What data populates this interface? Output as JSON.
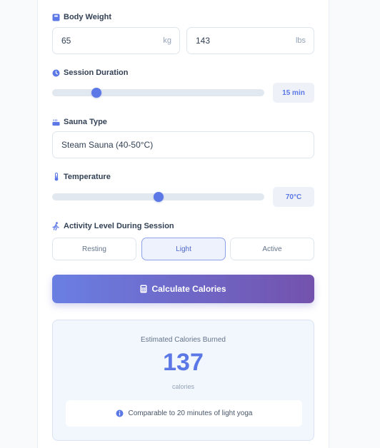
{
  "body_weight": {
    "label": "Body Weight",
    "icon": "weight-scale-icon",
    "kg_value": "65",
    "kg_unit": "kg",
    "lbs_value": "143",
    "lbs_unit": "lbs"
  },
  "session_duration": {
    "label": "Session Duration",
    "icon": "clock-icon",
    "slider_fraction": 0.21,
    "value_text": "15 min"
  },
  "sauna_type": {
    "label": "Sauna Type",
    "icon": "hot-tub-icon",
    "selected": "Steam Sauna (40-50°C)"
  },
  "temperature": {
    "label": "Temperature",
    "icon": "thermometer-icon",
    "slider_fraction": 0.5,
    "value_text": "70°C"
  },
  "activity": {
    "label": "Activity Level During Session",
    "icon": "running-person-icon",
    "options": [
      "Resting",
      "Light",
      "Active"
    ],
    "selected": "Light"
  },
  "calculate_button": {
    "label": "Calculate Calories",
    "icon": "calculator-icon"
  },
  "result": {
    "title": "Estimated Calories Burned",
    "value": "137",
    "unit": "calories",
    "note": "Comparable to 20 minutes of light yoga",
    "note_icon": "info-icon"
  },
  "colors": {
    "accent": "#5b78e6",
    "button_gradient_start": "#6a7fe3",
    "button_gradient_end": "#7352ad"
  }
}
